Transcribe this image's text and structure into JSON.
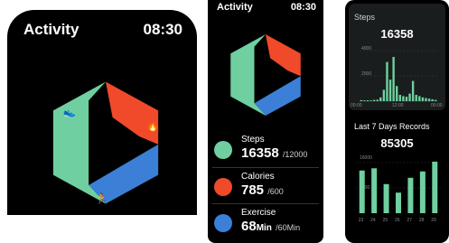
{
  "screen1": {
    "title": "Activity",
    "time": "08:30"
  },
  "screen2": {
    "title": "Activity",
    "time": "08:30",
    "metrics": [
      {
        "label": "Steps",
        "value": "16358",
        "goal": "/12000",
        "unit": "",
        "color": "#6fcfa0",
        "icon": "shoe-icon"
      },
      {
        "label": "Calories",
        "value": "785",
        "goal": "/600",
        "unit": "",
        "color": "#f04a2a",
        "icon": "flame-icon"
      },
      {
        "label": "Exercise",
        "value": "68",
        "goal": "/60Min",
        "unit": "Min",
        "color": "#3c7fd6",
        "icon": "runner-icon"
      }
    ]
  },
  "screen3": {
    "steps_label": "Steps",
    "steps_value": "16358",
    "steps_ymax": "4000",
    "steps_ymid": "2000",
    "steps_xticks": [
      "00:00",
      "12:00",
      "00:00"
    ],
    "week_label": "Last 7 Days Records",
    "week_value": "85305",
    "week_ymax": "16000",
    "week_ymid": "8000",
    "week_xticks": [
      "23",
      "24",
      "25",
      "26",
      "27",
      "28",
      "29"
    ]
  },
  "colors": {
    "steps": "#6fcfa0",
    "calories": "#f04a2a",
    "exercise": "#3c7fd6",
    "bars": "#6fcfa0"
  },
  "chart_data": [
    {
      "type": "bar",
      "title": "Steps",
      "x": [
        "00:00",
        "01:00",
        "02:00",
        "03:00",
        "04:00",
        "05:00",
        "06:00",
        "07:00",
        "08:00",
        "09:00",
        "10:00",
        "11:00",
        "12:00",
        "13:00",
        "14:00",
        "15:00",
        "16:00",
        "17:00",
        "18:00",
        "19:00",
        "20:00",
        "21:00",
        "22:00",
        "23:00"
      ],
      "values": [
        80,
        60,
        70,
        60,
        100,
        120,
        300,
        900,
        3100,
        1700,
        3500,
        1200,
        500,
        400,
        350,
        600,
        1600,
        500,
        400,
        300,
        250,
        200,
        150,
        100
      ],
      "ylim": [
        0,
        4000
      ]
    },
    {
      "type": "bar",
      "title": "Last 7 Days Records",
      "categories": [
        "23",
        "24",
        "25",
        "26",
        "27",
        "28",
        "29"
      ],
      "values": [
        13500,
        14200,
        9200,
        6500,
        11200,
        13200,
        16300
      ],
      "ylim": [
        0,
        16000
      ]
    }
  ]
}
